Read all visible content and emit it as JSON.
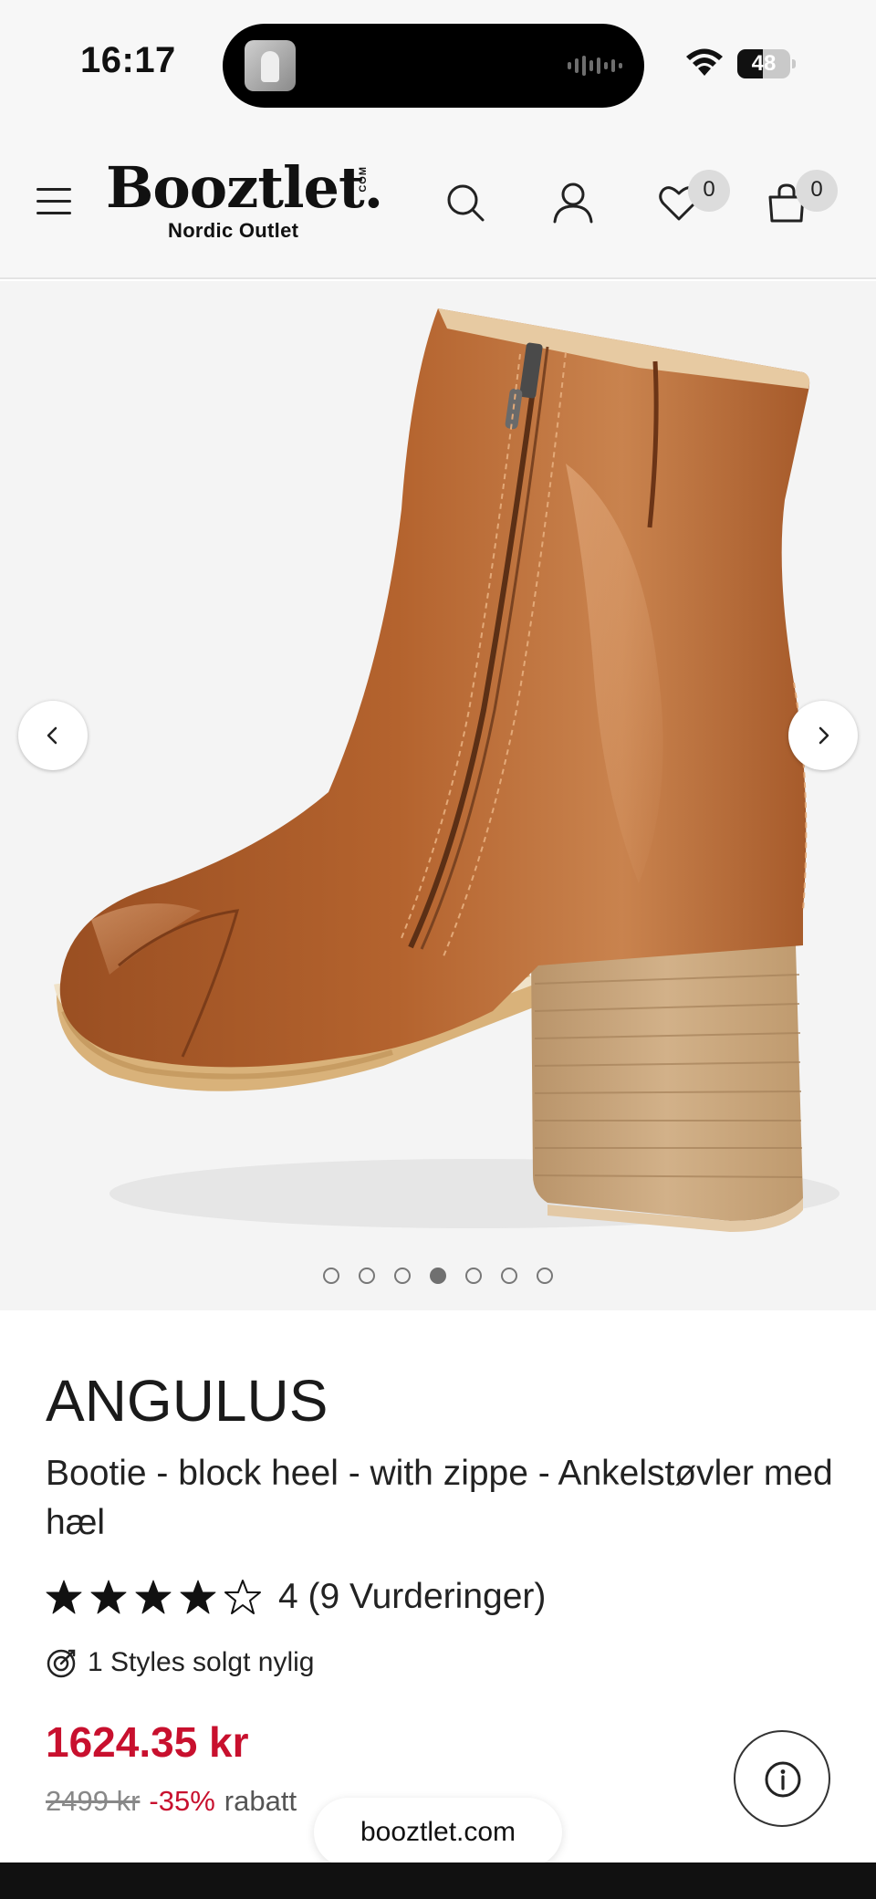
{
  "status_bar": {
    "time": "16:17",
    "battery": "48",
    "battery_level": 0.48,
    "icons": [
      "wifi-icon",
      "battery-icon",
      "audio-wave-icon"
    ]
  },
  "header": {
    "logo_text": "Booztlet.",
    "logo_suffix": "COM",
    "logo_subtitle": "Nordic Outlet",
    "wishlist_count": "0",
    "cart_count": "0",
    "icons": [
      "menu-icon",
      "search-icon",
      "account-icon",
      "heart-icon",
      "bag-icon"
    ]
  },
  "gallery": {
    "image": "brown leather ankle boot with block heel and side zipper",
    "image_count": 7,
    "active_index": 3,
    "icons": [
      "chevron-left-icon",
      "chevron-right-icon"
    ]
  },
  "product": {
    "brand": "ANGULUS",
    "title": "Bootie - block heel - with zippe - Ankelstøvler med hæl",
    "rating_value": 4,
    "rating_max": 5,
    "rating_text": "4 (9 Vurderinger)",
    "sold_text": "1 Styles solgt nylig",
    "price": "1624.35 kr",
    "old_price": "2499 kr",
    "discount": "-35%",
    "discount_label": "rabatt"
  },
  "browser": {
    "url": "booztlet.com"
  },
  "colors": {
    "price_red": "#c8102e",
    "header_bg": "#f7f7f7",
    "gallery_bg": "#f4f4f4",
    "leather": "#a8582a"
  }
}
